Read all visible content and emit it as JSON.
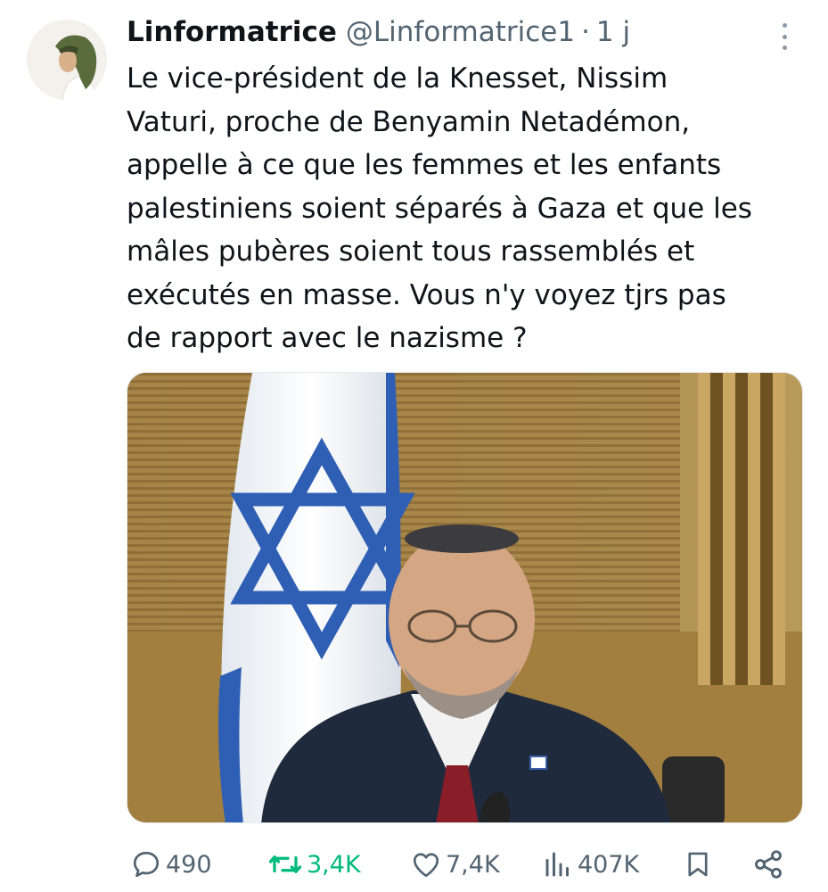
{
  "tweet": {
    "author_name": "Linformatrice",
    "author_handle": "@Linformatrice1",
    "separator": "·",
    "time": "1 j",
    "text_lines": [
      "Le vice-président de la Knesset, Nissim",
      "Vaturi, proche de Benyamin Netadémon,",
      "appelle à ce que les femmes et les enfants",
      "palestiniens soient séparés à Gaza et que les",
      "mâles pubères soient tous rassemblés et",
      "exécutés en masse. Vous n'y voyez tjrs pas",
      "de rapport avec le nazisme ?"
    ]
  },
  "actions": {
    "replies": "490",
    "retweets": "3,4K",
    "likes": "7,4K",
    "views": "407K"
  },
  "icons": {
    "more": "more-vertical-icon",
    "reply": "reply-icon",
    "retweet": "retweet-icon",
    "like": "heart-icon",
    "views": "views-chart-icon",
    "bookmark": "bookmark-icon",
    "share": "share-icon"
  },
  "colors": {
    "text": "#0f1419",
    "secondary": "#536471",
    "retweeted": "#00ba7c",
    "flag_blue": "#2f5fb4"
  }
}
